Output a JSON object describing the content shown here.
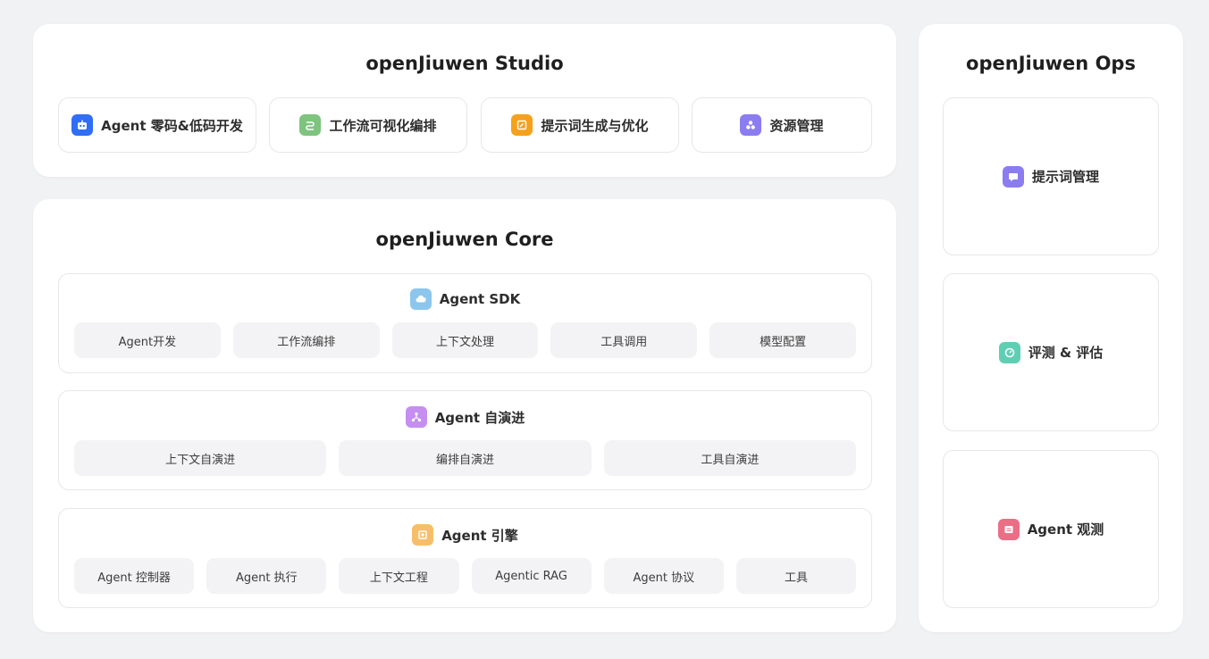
{
  "studio": {
    "title": "openJiuwen Studio",
    "items": [
      {
        "label": "Agent 零码&低码开发",
        "icon": "robot-icon",
        "color": "#2f6ef5"
      },
      {
        "label": "工作流可视化编排",
        "icon": "workflow-icon",
        "color": "#7ec47f"
      },
      {
        "label": "提示词生成与优化",
        "icon": "prompt-edit-icon",
        "color": "#f5a11c"
      },
      {
        "label": "资源管理",
        "icon": "resources-icon",
        "color": "#8b7cf0"
      }
    ]
  },
  "core": {
    "title": "openJiuwen Core",
    "sdk": {
      "title": "Agent SDK",
      "icon": "cloud-icon",
      "color": "#8cc6ec",
      "chips": [
        "Agent开发",
        "工作流编排",
        "上下文处理",
        "工具调用",
        "模型配置"
      ]
    },
    "evolution": {
      "title": "Agent 自演进",
      "icon": "network-icon",
      "color": "#c58ef0",
      "chips": [
        "上下文自演进",
        "编排自演进",
        "工具自演进"
      ]
    },
    "engine": {
      "title": "Agent 引擎",
      "icon": "engine-icon",
      "color": "#f7be6a",
      "chips": [
        "Agent 控制器",
        "Agent 执行",
        "上下文工程",
        "Agentic RAG",
        "Agent 协议",
        "工具"
      ]
    }
  },
  "ops": {
    "title": "openJiuwen Ops",
    "items": [
      {
        "label": "提示词管理",
        "icon": "chat-bubble-icon",
        "color": "#8b7cf0"
      },
      {
        "label": "评测 & 评估",
        "icon": "gauge-icon",
        "color": "#5fcfb4"
      },
      {
        "label": "Agent 观测",
        "icon": "monitor-icon",
        "color": "#ea6f86"
      }
    ]
  }
}
